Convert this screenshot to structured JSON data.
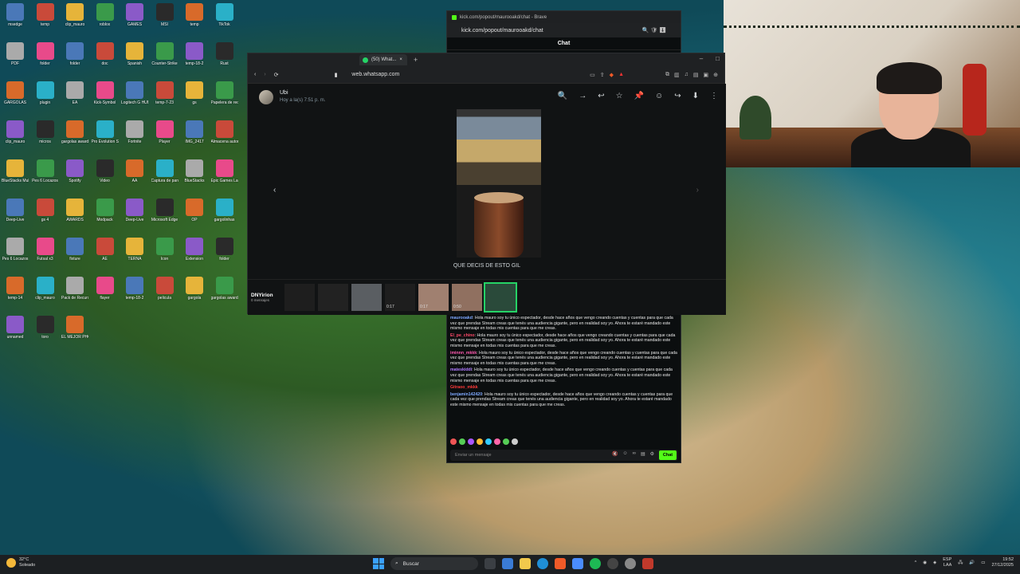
{
  "colors": {
    "kick_green": "#53fc18",
    "whatsapp_green": "#25d366"
  },
  "desktop_icons": [
    "msedge",
    "temp",
    "clip_mauro",
    "roblox",
    "GAMES",
    "MSI",
    "temp",
    "TikTok",
    "PDF",
    "folder",
    "folder",
    "doc",
    "Spanish",
    "Counter-Strike",
    "temp-18-2",
    "Rust",
    "GARGOLAS",
    "plugin",
    "EA",
    "Kick-Symbol",
    "Logitech G HUB",
    "temp-7-23",
    "gs",
    "Papelera de reciclaje",
    "clip_mauro",
    "micros",
    "gargolas awards",
    "Pro Evolution Soccer",
    "Fortnite",
    "Player",
    "IMG_2417",
    "Almacena automatic",
    "BlueStacks Multi-Insta",
    "Pes 6 Locazos",
    "Spotify",
    "Video",
    "AA",
    "Captura de pantalla",
    "BlueStacks",
    "Epic Games Launcher",
    "Deep-Live",
    "gs 4",
    "AWARDS",
    "Modpack",
    "Deep-Live",
    "Microsoft Edge",
    "OP",
    "gargolinhas",
    "Pes 6 Locazos",
    "Futsal x3",
    "fixture",
    "AE",
    "TERNA",
    "Icon",
    "Extension",
    "folder",
    "temp-14",
    "clip_mauro",
    "Pack de Recursos",
    "flayer",
    "temp-18-2",
    "pelicula",
    "gargola",
    "gargolas awards",
    "unnamed",
    "toro",
    "EL MEJOR PHONK"
  ],
  "kick": {
    "url": "kick.com/popout/maurooakd/chat",
    "window_title": "kick.com/popout/maurooakd/chat - Brave",
    "header": "Chat",
    "messages": [
      {
        "user": "maurooakd",
        "user_color": "#7ea8ff",
        "text": "Hola mauro soy tu único espectador, desde hace años que vengo creando cuentas y cuentas para que cada vez que prendas Stream creas que tenés una audiencia gigante, pero en realidad soy yo. Ahora te estaré mandado este mismo mensaje en todas mis cuentas para que me creas."
      },
      {
        "user": "El_pe_chino",
        "user_color": "#ff4a6a",
        "text": "Hola mauro soy tu único espectador, desde hace años que vengo creando cuentas y cuentas para que cada vez que prendas Stream creas que tenés una audiencia gigante, pero en realidad soy yo. Ahora te estaré mandado este mismo mensaje en todas mis cuentas para que me creas."
      },
      {
        "user": "iminnn_mkkk",
        "user_color": "#ff5ab0",
        "text": "Hola mauro soy tu único espectador, desde hace años que vengo creando cuentas y cuentas para que cada vez que prendas Stream creas que tenés una audiencia gigante, pero en realidad soy yo. Ahora te estaré mandado este mismo mensaje en todas mis cuentas para que me creas."
      },
      {
        "user": "mateskiddi",
        "user_color": "#b07aff",
        "text": "Hola mauro soy tu único espectador, desde hace años que vengo creando cuentas y cuentas para que cada vez que prendas Stream creas que tenés una audiencia gigante, pero en realidad soy yo. Ahora te estaré mandado este mismo mensaje en todas mis cuentas para que me creas."
      },
      {
        "user": "Gitraoo_mkkk",
        "user_color": "#ff3a3a",
        "text": ""
      },
      {
        "user": "benjamin142420",
        "user_color": "#7ea8ff",
        "text": "Hola mauro soy tu único espectador, desde hace años que vengo creando cuentas y cuentas para que cada vez que prendas Stream creas que tenés una audiencia gigante, pero en realidad soy yo. Ahora te estaré mandado este mismo mensaje en todas mis cuentas para que me creas."
      }
    ],
    "input_placeholder": "Enviar un mensaje",
    "send_label": "Chat",
    "input_icons": [
      "🔇",
      "☺",
      "∞",
      "▤",
      "⚙"
    ]
  },
  "whatsapp": {
    "tab_title": "(50) What...",
    "url": "web.whatsapp.com",
    "sender_name": "Ubi",
    "sender_time": "Hoy a la(s) 7:51 p. m.",
    "toolbar_icons": [
      "🔍",
      "→",
      "↩",
      "☆",
      "📌",
      "☺",
      "↪",
      "⬇",
      "⋮"
    ],
    "caption": "QUE DECIS DE ESTO GIL",
    "thumb_text": {
      "title": "DNYirion",
      "sub": "0 mensajes"
    },
    "thumbs": [
      {
        "duration": ""
      },
      {
        "duration": ""
      },
      {
        "duration": ""
      },
      {
        "duration": "0:17"
      },
      {
        "duration": "0:17"
      },
      {
        "duration": "0:50"
      },
      {
        "duration": ""
      }
    ]
  },
  "taskbar": {
    "weather_temp": "32°C",
    "weather_desc": "Soleado",
    "search_placeholder": "Buscar",
    "lang_top": "ESP",
    "lang_bottom": "LAA",
    "time": "19:52",
    "date": "27/12/2025"
  }
}
